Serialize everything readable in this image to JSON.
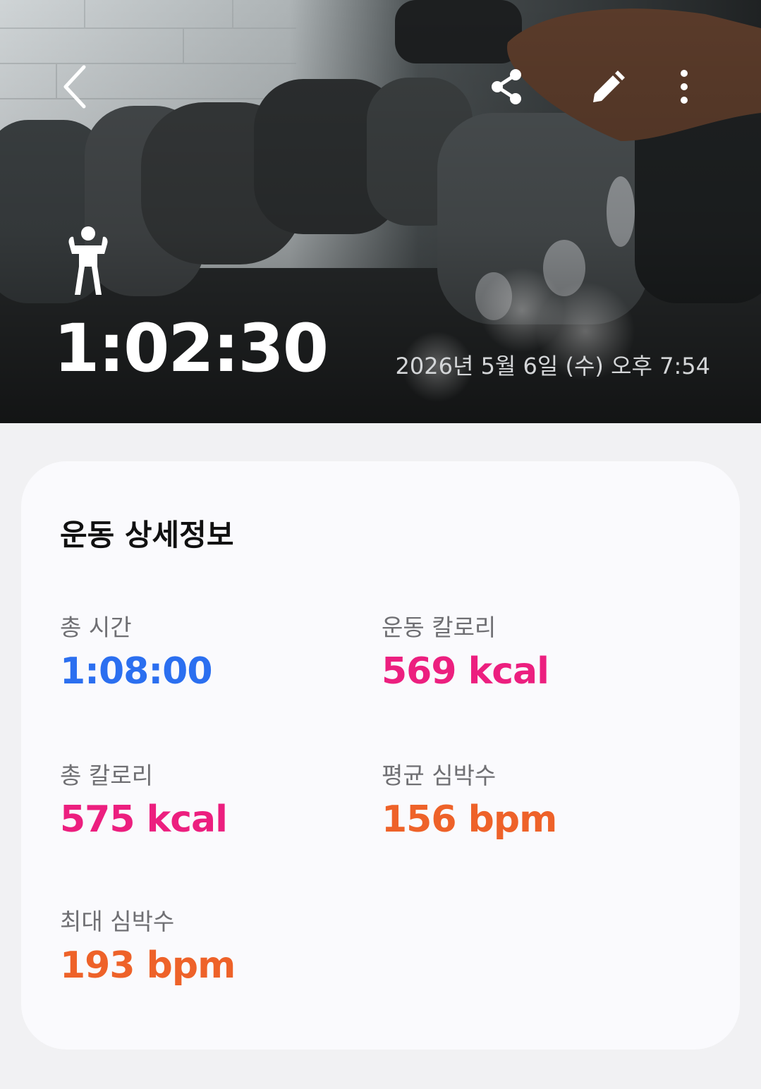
{
  "header": {
    "duration": "1:02:30",
    "datetime": "2026년 5월 6일 (수) 오후 7:54",
    "icons": {
      "back": "back-chevron-icon",
      "share": "share-icon",
      "edit": "edit-pencil-icon",
      "more": "more-vertical-icon",
      "exercise": "strength-exercise-icon"
    }
  },
  "details": {
    "title": "운동 상세정보",
    "stats": [
      {
        "label": "총 시간",
        "value": "1:08:00",
        "color": "#2b6ff0"
      },
      {
        "label": "운동 칼로리",
        "value": "569 kcal",
        "color": "#ec1f7f"
      },
      {
        "label": "총 칼로리",
        "value": "575 kcal",
        "color": "#ec1f7f"
      },
      {
        "label": "평균 심박수",
        "value": "156 bpm",
        "color": "#ee6229"
      },
      {
        "label": "최대 심박수",
        "value": "193 bpm",
        "color": "#ee6229"
      }
    ]
  }
}
